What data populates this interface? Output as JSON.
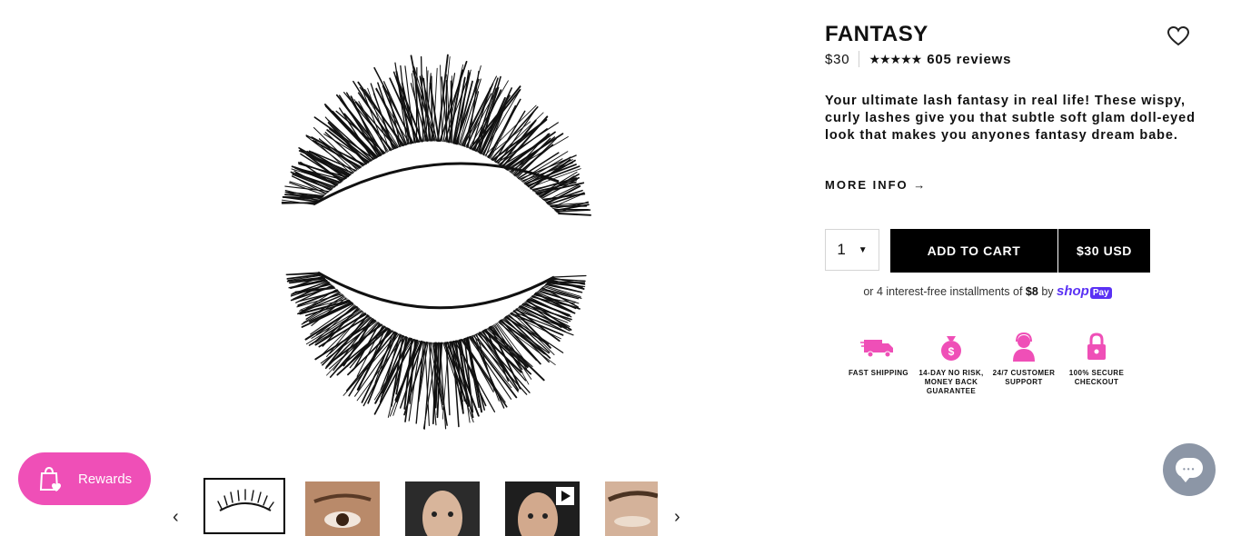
{
  "product": {
    "title": "FANTASY",
    "price": "$30",
    "rating_stars": "★★★★★",
    "rating_value": 5,
    "reviews_label": "605 reviews",
    "description": "Your ultimate lash fantasy in real life! These wispy, curly lashes give you that subtle soft glam doll-eyed look that makes you anyones fantasy dream babe.",
    "more_info_label": "MORE INFO →"
  },
  "purchase": {
    "quantity": "1",
    "add_to_cart_label": "ADD TO CART",
    "add_to_cart_price": "$30 USD",
    "installments_prefix": "or 4 interest-free installments of",
    "installments_amount": "$8",
    "installments_by": "by",
    "shop_logo": "shop",
    "pay_badge": "Pay"
  },
  "features": [
    {
      "icon": "truck-icon",
      "label": "FAST SHIPPING"
    },
    {
      "icon": "money-bag-icon",
      "label": "14-DAY NO RISK, MONEY BACK GUARANTEE"
    },
    {
      "icon": "support-agent-icon",
      "label": "24/7 CUSTOMER SUPPORT"
    },
    {
      "icon": "padlock-icon",
      "label": "100% SECURE CHECKOUT"
    }
  ],
  "gallery": {
    "thumbnails": [
      "lash-product",
      "eye-closeup",
      "model-face",
      "model-video",
      "eye-brow-closeup"
    ],
    "active_index": 0
  },
  "rewards": {
    "label": "Rewards"
  },
  "colors": {
    "accent_pink": "#ef4fb7",
    "shop_purple": "#5a31f4",
    "button_black": "#000000",
    "chat_gray": "#8c96a6"
  }
}
